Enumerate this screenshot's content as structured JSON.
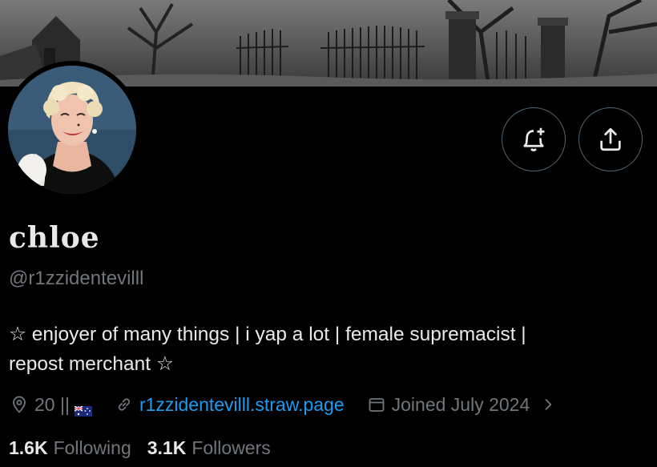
{
  "profile": {
    "display_name": "chloe",
    "handle": "@r1zzidentevilll",
    "bio_line1": "☆ enjoyer of many things | i yap a lot | female supremacist |",
    "bio_line2": "repost merchant ☆",
    "location": "20 ||",
    "location_flag": "australia-flag",
    "website": "r1zzidentevilll.straw.page",
    "joined": "Joined July 2024"
  },
  "stats": {
    "following_count": "1.6K",
    "following_label": "Following",
    "followers_count": "3.1K",
    "followers_label": "Followers"
  },
  "icons": {
    "notify": "bell-plus-icon",
    "share": "share-icon",
    "location": "location-pin-icon",
    "link": "link-icon",
    "calendar": "calendar-icon",
    "chevron": "chevron-right-icon"
  },
  "colors": {
    "background": "#000000",
    "primary_text": "#e7e9ea",
    "secondary_text": "#71767b",
    "link": "#1d9bf0",
    "button_border": "#536471"
  }
}
